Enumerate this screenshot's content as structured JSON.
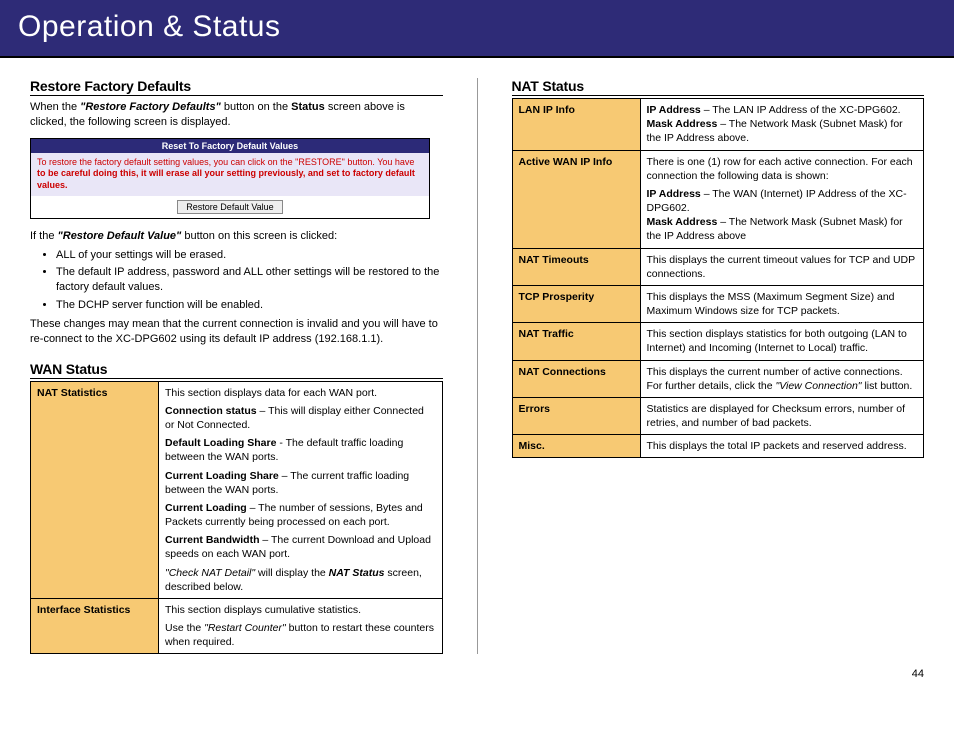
{
  "banner": "Operation & Status",
  "page_number": "44",
  "left": {
    "restore": {
      "heading": "Restore Factory Defaults",
      "intro_1": "When the ",
      "intro_bi": "\"Restore Factory Defaults\"",
      "intro_2": " button on the ",
      "intro_b": "Status",
      "intro_3": " screen above is clicked, the following screen is displayed.",
      "router_title": "Reset To Factory Default Values",
      "router_line1": "To restore the factory default setting values, you can click on the \"RESTORE\" button. You have",
      "router_line2": "to be careful doing this, it will erase all your setting previously, and set to factory default values.",
      "router_button": "Restore Default Value",
      "after_intro_1": "If the ",
      "after_intro_bi": "\"Restore Default Value\"",
      "after_intro_2": " button on this screen is clicked:",
      "bullet1": "ALL of your settings will be erased.",
      "bullet2": "The default IP address, password and ALL other settings will be restored to the factory default values.",
      "bullet3": "The DCHP server function will be enabled.",
      "closing": "These changes may mean that the current connection is invalid and you will have to re-connect to the XC-DPG602 using its default IP address (192.168.1.1)."
    },
    "wan": {
      "heading": "WAN Status",
      "rows": [
        {
          "label": "NAT Statistics",
          "desc_lead": "This section displays data for each WAN port.",
          "items": [
            {
              "b": "Connection status",
              "t": " – This will display either Connected or Not Connected."
            },
            {
              "b": "Default Loading Share",
              "t": " - The default traffic loading between the WAN ports."
            },
            {
              "b": "Current Loading Share",
              "t": " – The current traffic loading between the WAN ports."
            },
            {
              "b": "Current Loading",
              "t": " – The number of sessions, Bytes and Packets currently being processed on each port."
            },
            {
              "b": "Current Bandwidth",
              "t": " – The current Download and Upload speeds on each WAN port."
            }
          ],
          "tail_i1": "\"Check NAT Detail\"",
          "tail_mid": " will display the ",
          "tail_bi": "NAT Status",
          "tail_end": " screen, described below."
        },
        {
          "label": "Interface Statistics",
          "desc_lead": "This section displays cumulative statistics.",
          "tail_pre": "Use the ",
          "tail_i1": "\"Restart Counter\"",
          "tail_end": " button to restart these counters when required."
        }
      ]
    }
  },
  "right": {
    "nat": {
      "heading": "NAT Status",
      "rows": [
        {
          "label": "LAN IP Info",
          "items": [
            {
              "b": "IP Address",
              "t": " – The LAN IP Address of the XC-DPG602."
            },
            {
              "b": "Mask Address",
              "t": " – The Network Mask (Subnet Mask) for the IP Address above."
            }
          ]
        },
        {
          "label": "Active WAN IP Info",
          "lead": "There is one (1) row for each active connection. For each connection the following data is shown:",
          "items": [
            {
              "b": "IP Address",
              "t": " – The WAN (Internet) IP Address of the XC-DPG602."
            },
            {
              "b": "Mask Address",
              "t": " – The Network Mask (Subnet Mask) for the IP Address above"
            }
          ]
        },
        {
          "label": "NAT Timeouts",
          "plain": "This displays the current timeout values for TCP and UDP connections."
        },
        {
          "label": "TCP Prosperity",
          "plain": "This displays the MSS (Maximum Segment Size) and Maximum Windows size for TCP packets."
        },
        {
          "label": "NAT Traffic",
          "plain": "This section displays statistics for both outgoing (LAN to Internet) and Incoming (Internet to Local) traffic."
        },
        {
          "label": "NAT Connections",
          "pre": "This displays the current number of active connections. For further details, click the ",
          "i": "\"View Connection\"",
          "post": " list button."
        },
        {
          "label": "Errors",
          "plain": "Statistics are displayed for Checksum errors, number of retries, and number of bad packets."
        },
        {
          "label": "Misc.",
          "plain": "This displays the total IP packets and reserved address."
        }
      ]
    }
  }
}
